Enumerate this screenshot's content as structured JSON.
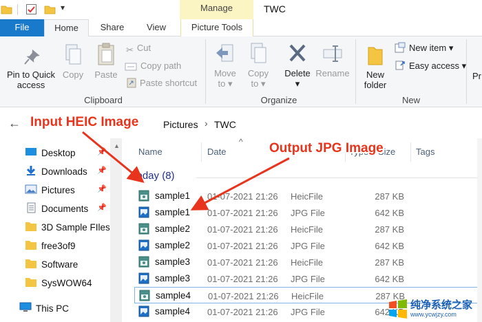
{
  "window": {
    "title": "TWC",
    "manage_label": "Manage"
  },
  "tabs": {
    "file": "File",
    "home": "Home",
    "share": "Share",
    "view": "View",
    "picture_tools": "Picture Tools"
  },
  "ribbon": {
    "pin_to_quick_access_1": "Pin to Quick",
    "pin_to_quick_access_2": "access",
    "copy": "Copy",
    "paste": "Paste",
    "cut": "Cut",
    "copy_path": "Copy path",
    "paste_shortcut": "Paste shortcut",
    "clipboard_group": "Clipboard",
    "move_to_1": "Move",
    "move_to_2": "to",
    "copy_to_1": "Copy",
    "copy_to_2": "to",
    "delete": "Delete",
    "rename": "Rename",
    "organize_group": "Organize",
    "new_folder_1": "New",
    "new_folder_2": "folder",
    "new_item": "New item",
    "easy_access": "Easy access",
    "new_group": "New",
    "properties_partial": "Pr"
  },
  "address": {
    "crumbs": [
      "Pictures",
      "TWC"
    ]
  },
  "nav": {
    "items": [
      {
        "label": "Desktop",
        "icon": "desktop-icon",
        "pinned": true
      },
      {
        "label": "Downloads",
        "icon": "downloads-icon",
        "pinned": true
      },
      {
        "label": "Pictures",
        "icon": "pictures-icon",
        "pinned": true
      },
      {
        "label": "Documents",
        "icon": "documents-icon",
        "pinned": true
      },
      {
        "label": "3D Sample FIles",
        "icon": "folder-icon",
        "pinned": false
      },
      {
        "label": "free3of9",
        "icon": "folder-icon",
        "pinned": false
      },
      {
        "label": "Software",
        "icon": "folder-icon",
        "pinned": false
      },
      {
        "label": "SysWOW64",
        "icon": "folder-icon",
        "pinned": false
      },
      {
        "label": "This PC",
        "icon": "this-pc-icon",
        "pinned": false
      }
    ]
  },
  "columns": {
    "name": "Name",
    "date": "Date",
    "type": "Type",
    "size": "Size",
    "tags": "Tags"
  },
  "group": {
    "label": "Today (8)"
  },
  "files": [
    {
      "name": "sample1",
      "date": "01-07-2021 21:26",
      "type": "HeicFile",
      "size": "287 KB",
      "kind": "heic"
    },
    {
      "name": "sample1",
      "date": "01-07-2021 21:26",
      "type": "JPG File",
      "size": "642 KB",
      "kind": "jpg"
    },
    {
      "name": "sample2",
      "date": "01-07-2021 21:26",
      "type": "HeicFile",
      "size": "287 KB",
      "kind": "heic"
    },
    {
      "name": "sample2",
      "date": "01-07-2021 21:26",
      "type": "JPG File",
      "size": "642 KB",
      "kind": "jpg"
    },
    {
      "name": "sample3",
      "date": "01-07-2021 21:26",
      "type": "HeicFile",
      "size": "287 KB",
      "kind": "heic"
    },
    {
      "name": "sample3",
      "date": "01-07-2021 21:26",
      "type": "JPG File",
      "size": "642 KB",
      "kind": "jpg"
    },
    {
      "name": "sample4",
      "date": "01-07-2021 21:26",
      "type": "HeicFile",
      "size": "287 KB",
      "kind": "heic"
    },
    {
      "name": "sample4",
      "date": "01-07-2021 21:26",
      "type": "JPG File",
      "size": "642 KB",
      "kind": "jpg"
    }
  ],
  "annotations": {
    "input": "Input HEIC Image",
    "output": "Output JPG Image"
  },
  "watermark": {
    "text": "纯净系统之家",
    "url": "www.ycwjzy.com"
  },
  "colors": {
    "accent": "#1979ca",
    "manage_tab": "#fbf5c3",
    "annotation": "#e8341c",
    "group_heading": "#1e3287"
  }
}
